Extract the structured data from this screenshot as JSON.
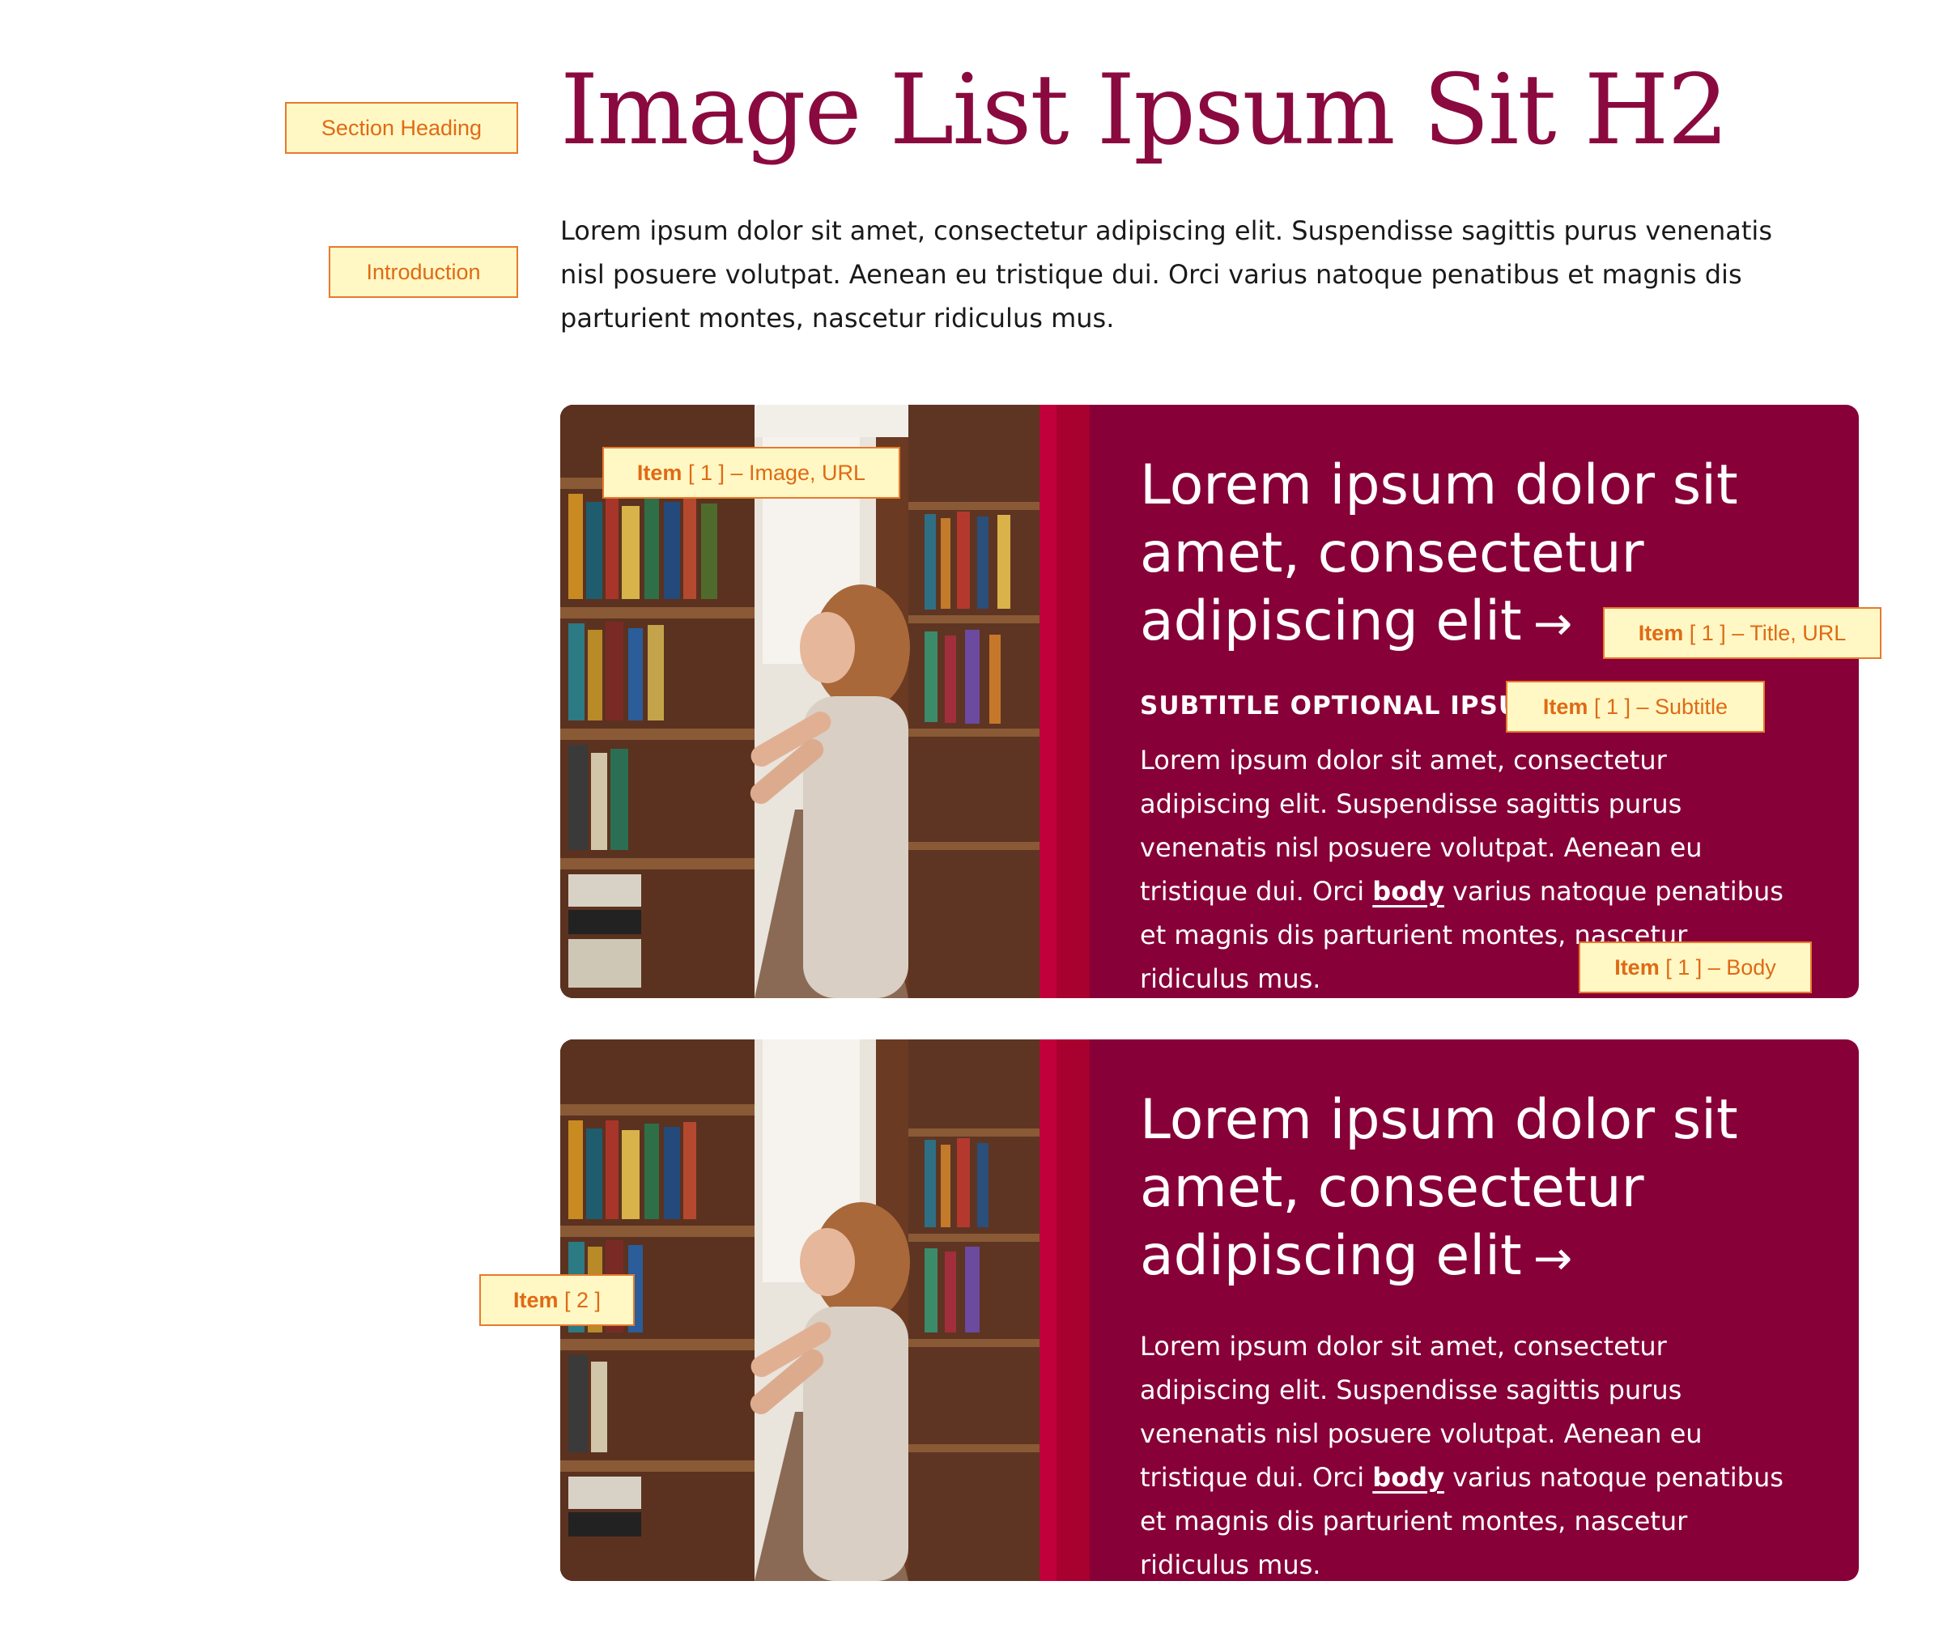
{
  "section": {
    "heading": "Image List Ipsum Sit H2",
    "introduction": "Lorem ipsum dolor sit amet, consectetur adipiscing elit. Suspendisse sagittis purus venenatis nisl posuere volutpat. Aenean eu tristique dui. Orci varius natoque penatibus et magnis dis parturient montes, nascetur ridiculus mus."
  },
  "annotations": {
    "section_heading": "Section Heading",
    "introduction": "Introduction",
    "item1_image": {
      "bold": "Item",
      "rest": " [ 1 ] – Image, URL"
    },
    "item1_title": {
      "bold": "Item",
      "rest": " [ 1 ] – Title, URL"
    },
    "item1_subtitle": {
      "bold": "Item",
      "rest": " [ 1 ] – Subtitle"
    },
    "item1_body": {
      "bold": "Item",
      "rest": " [ 1 ] – Body"
    },
    "item2": {
      "bold": "Item",
      "rest": " [ 2 ]"
    }
  },
  "items": [
    {
      "title": "Lorem ipsum dolor sit amet, consectetur adipiscing elit",
      "arrow": "→",
      "subtitle": "SUBTITLE OPTIONAL IPSUM",
      "body_before": "Lorem ipsum dolor sit amet, consectetur adipiscing elit. Suspendisse sagittis purus venenatis nisl posuere volutpat. Aenean eu tristique dui. Orci ",
      "body_link": "body",
      "body_after": " varius natoque penatibus et magnis dis parturient montes, nascetur ridiculus mus."
    },
    {
      "title": "Lorem ipsum dolor sit amet, consectetur adipiscing elit",
      "arrow": "→",
      "body_before": "Lorem ipsum dolor sit amet, consectetur adipiscing elit. Suspendisse sagittis purus venenatis nisl posuere volutpat. Aenean eu tristique dui. Orci ",
      "body_link": "body",
      "body_after": " varius natoque penatibus et magnis dis parturient montes, nascetur ridiculus mus."
    }
  ],
  "colors": {
    "heading": "#8a0a3f",
    "card_background": "#870038",
    "accent_stripe": "#c0003a",
    "annotation_fill": "#fff8c4",
    "annotation_border": "#e8792d"
  }
}
